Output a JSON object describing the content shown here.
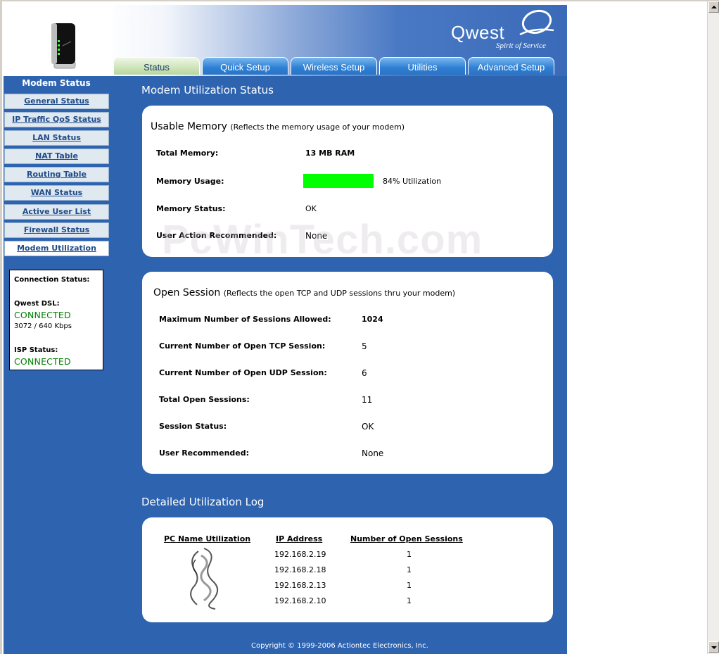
{
  "brand": {
    "name": "Qwest",
    "tagline": "Spirit of Service"
  },
  "tabs": [
    "Status",
    "Quick Setup",
    "Wireless Setup",
    "Utilities",
    "Advanced Setup"
  ],
  "sidebar": {
    "title": "Modem Status",
    "items": [
      {
        "label": "General Status"
      },
      {
        "label": "IP Traffic QoS Status"
      },
      {
        "label": "LAN Status"
      },
      {
        "label": "NAT Table"
      },
      {
        "label": "Routing Table"
      },
      {
        "label": "WAN Status"
      },
      {
        "label": "Active User List"
      },
      {
        "label": "Firewall Status"
      },
      {
        "label": "Modem Utilization"
      }
    ]
  },
  "connection": {
    "title": "Connection Status:",
    "dsl_label": "Qwest DSL:",
    "dsl_status": "CONNECTED",
    "speed": "3072 / 640 Kbps",
    "isp_label": "ISP Status:",
    "isp_status": "CONNECTED",
    "status_color": "#008000"
  },
  "page_title": "Modem Utilization Status",
  "memory": {
    "title": "Usable Memory",
    "subtitle": "(Reflects the memory usage of your modem)",
    "total_label": "Total Memory:",
    "total_value": "13 MB RAM",
    "usage_label": "Memory Usage:",
    "usage_text": "84% Utilization",
    "usage_fraction": 0.84,
    "bar_color": "#00ff00",
    "status_label": "Memory Status:",
    "status_value": "OK",
    "action_label": "User Action Recommended:",
    "action_value": "None"
  },
  "watermark": "PcWinTech.com",
  "sessions": {
    "title": "Open Session",
    "subtitle": "(Reflects the open TCP and UDP sessions thru your modem)",
    "rows": [
      {
        "label": "Maximum Number of Sessions Allowed:",
        "value": "1024"
      },
      {
        "label": "Current Number of Open TCP Session:",
        "value": "5"
      },
      {
        "label": "Current Number of Open UDP Session:",
        "value": "6"
      },
      {
        "label": "Total Open Sessions:",
        "value": "11"
      },
      {
        "label": "Session Status:",
        "value": "OK"
      },
      {
        "label": "User Recommended:",
        "value": "None"
      }
    ]
  },
  "log": {
    "title": "Detailed Utilization Log",
    "headers": [
      "PC Name Utilization",
      "IP Address",
      "Number of Open Sessions"
    ],
    "rows": [
      {
        "ip": "192.168.2.19",
        "sessions": "1"
      },
      {
        "ip": "192.168.2.18",
        "sessions": "1"
      },
      {
        "ip": "192.168.2.13",
        "sessions": "1"
      },
      {
        "ip": "192.168.2.10",
        "sessions": "1"
      }
    ]
  },
  "footer": "Copyright © 1999-2006 Actiontec Electronics, Inc."
}
